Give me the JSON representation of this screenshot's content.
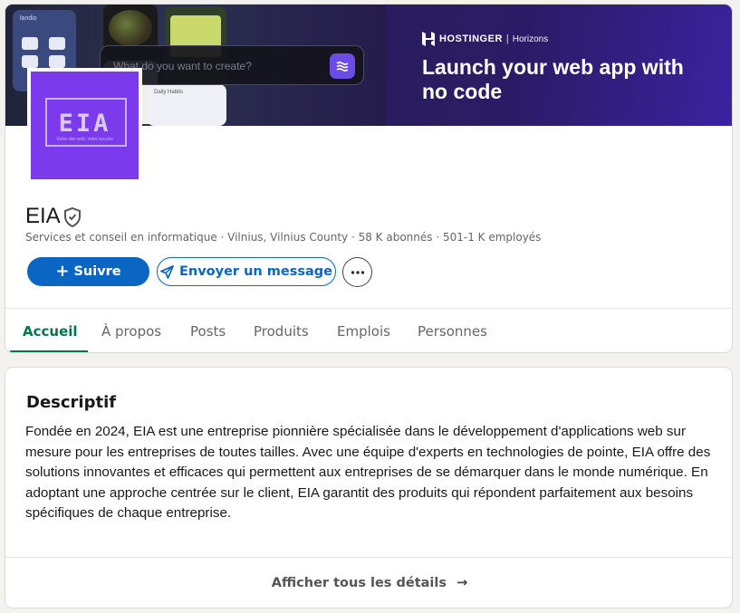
{
  "banner": {
    "mock_app_name": "landio",
    "mock_card_title": "Daily Habits",
    "prompt_placeholder": "What do you want to create?",
    "brand": "HOSTINGER",
    "brand_sub": "Horizons",
    "headline": "Launch your web app with no code"
  },
  "logo": {
    "text": "EIA",
    "tagline": "Votre site web, votre succès"
  },
  "company": {
    "name": "EIA",
    "meta": "Services et conseil en informatique · Vilnius, Vilnius County · 58 K abonnés · 501-1 K employés"
  },
  "actions": {
    "follow_label": "Suivre",
    "follow_icon": "+",
    "message_label": "Envoyer un message",
    "more_icon": "ellipsis-icon"
  },
  "tabs": [
    {
      "label": "Accueil",
      "active": true
    },
    {
      "label": "À propos",
      "active": false
    },
    {
      "label": "Posts",
      "active": false
    },
    {
      "label": "Produits",
      "active": false
    },
    {
      "label": "Emplois",
      "active": false
    },
    {
      "label": "Personnes",
      "active": false
    }
  ],
  "about": {
    "title": "Descriptif",
    "text": "Fondée en 2024, EIA est une entreprise pionnière spécialisée dans le développement d'applications web sur mesure pour les entreprises de toutes tailles. Avec une équipe d'experts en technologies de pointe, EIA offre des solutions innovantes et efficaces qui permettent aux entreprises de se démarquer dans le monde numérique. En adoptant une approche centrée sur le client, EIA garantit des produits qui répondent parfaitement aux besoins spécifiques de chaque entreprise.",
    "show_all_label": "Afficher tous les détails",
    "show_all_icon": "→"
  },
  "colors": {
    "primary": "#0a66c2",
    "active_tab": "#01754f",
    "logo_bg": "#7c3aed",
    "banner_bg": "#2a1d5c"
  }
}
